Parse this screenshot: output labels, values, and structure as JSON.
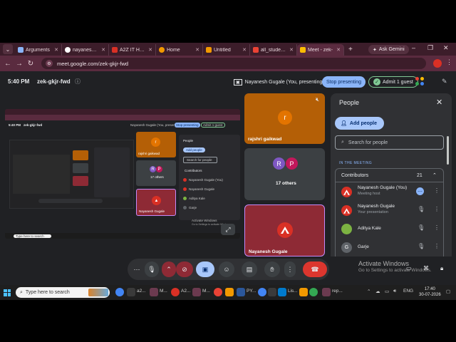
{
  "browser": {
    "tabs": [
      {
        "label": "Arguments",
        "color": "#8ab4f8"
      },
      {
        "label": "nayanesh-gu",
        "color": "#ffffff"
      },
      {
        "label": "A2Z IT HUB",
        "color": "#d93025"
      },
      {
        "label": "Home",
        "color": "#f29900"
      },
      {
        "label": "Untitled",
        "color": "#f29900"
      },
      {
        "label": "all_students",
        "color": "#ea4335"
      },
      {
        "label": "Meet - zek-",
        "color": "#fbbc04"
      }
    ],
    "active_tab_index": 6,
    "gemini_label": "Ask Gemini",
    "url": "meet.google.com/zek-gkjr-fwd"
  },
  "meet": {
    "time": "5:40 PM",
    "code": "zek-gkjr-fwd",
    "presenting_label": "Nayanesh Gugale (You, presenting)",
    "stop_presenting": "Stop presenting",
    "admit": "Admit 1 guest"
  },
  "shared_screen": {
    "texts": [
      "5:40 PM",
      "zek-gkjr-fwd",
      "Nayanesh Gugale (You, presenting)",
      "Stop presenting",
      "Admit 1 guest",
      "People",
      "Add people",
      "Search for people",
      "Contributors",
      "Nayanesh Gugale (You)",
      "Nayanesh Gugale",
      "Aditya Kale",
      "Garje",
      "rajshri gaikwad",
      "17 others",
      "Nayanesh Gugale",
      "Type here to search",
      "Activate Windows",
      "Go to Settings to activate Windows."
    ]
  },
  "tiles": {
    "t1_name": "rajshri gaikwad",
    "t1_initial": "r",
    "t2_name": "17 others",
    "t2_initial_a": "R",
    "t2_initial_b": "P",
    "t3_name": "Nayanesh Gugale"
  },
  "people_panel": {
    "title": "People",
    "add_people": "Add people",
    "search_placeholder": "Search for people",
    "in_meeting": "IN THE MEETING",
    "contributors_label": "Contributors",
    "contributors_count": "21",
    "participants": [
      {
        "name": "Nayanesh Gugale (You)",
        "sub": "Meeting host",
        "avatar": "logo"
      },
      {
        "name": "Nayanesh Gugale",
        "sub": "Your presentation",
        "avatar": "logo"
      },
      {
        "name": "Aditya Kale",
        "sub": "",
        "avatar": "photo"
      },
      {
        "name": "Garje",
        "sub": "",
        "avatar": "G"
      }
    ]
  },
  "watermark": {
    "title": "Activate Windows",
    "sub": "Go to Settings to activate Windows."
  },
  "taskbar": {
    "search_placeholder": "Type here to search",
    "app_labels": [
      "a2...",
      "M...",
      "A2...",
      "M...",
      "PY...",
      "Lis...",
      "rep..."
    ],
    "tray_lang": "ENG",
    "time": "17:40",
    "date": "30-07-2026"
  },
  "colors": {
    "accent_blue": "#8ab4f8",
    "tile_orange": "#b45f06",
    "tile_red": "#8e2a35",
    "hangup_red": "#dc362e"
  }
}
